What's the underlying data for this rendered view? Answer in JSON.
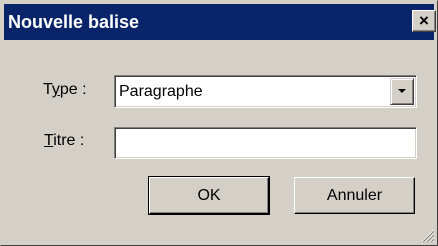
{
  "dialog": {
    "title": "Nouvelle balise",
    "close_glyph": "×"
  },
  "form": {
    "type_label_pre": "T",
    "type_label_u": "y",
    "type_label_post": "pe :",
    "type_value": "Paragraphe",
    "titre_label_u": "T",
    "titre_label_post": "itre :",
    "titre_value": ""
  },
  "buttons": {
    "ok_label": "OK",
    "cancel_label": "Annuler"
  },
  "icons": {
    "close": "close-icon",
    "dropdown": "chevron-down-icon",
    "resize": "resize-grip-icon"
  }
}
